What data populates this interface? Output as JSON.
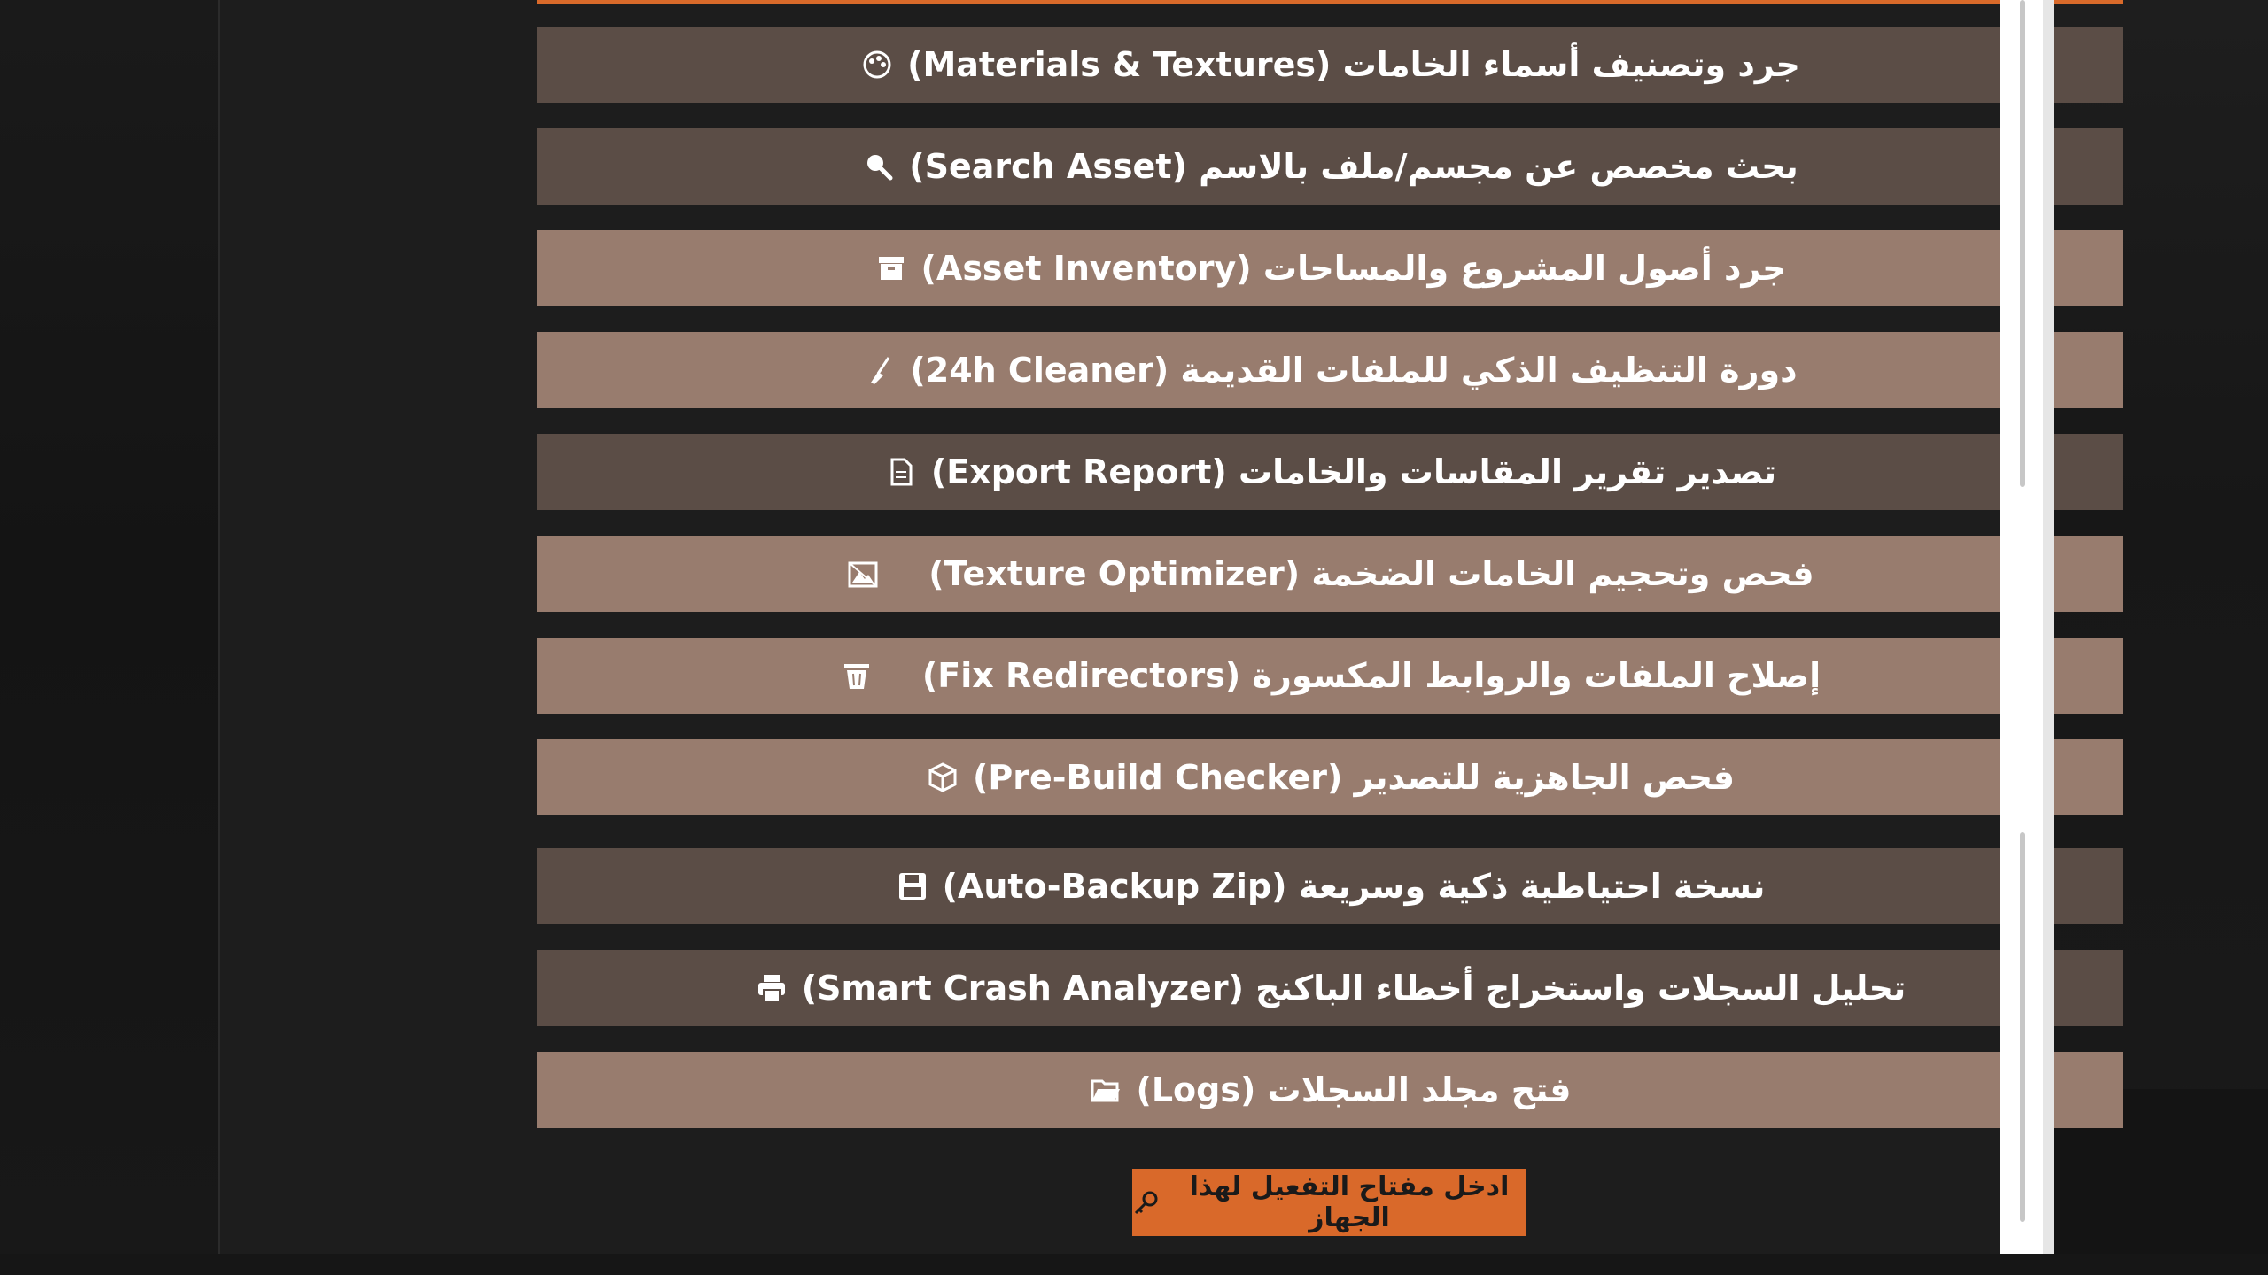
{
  "tools": [
    {
      "label": "جرد وتصنيف أسماء الخامات (Materials & Textures)",
      "icon": "palette-icon",
      "tone": "dark"
    },
    {
      "label": "بحث مخصص عن مجسم/ملف بالاسم (Search Asset)",
      "icon": "magnifier-icon",
      "tone": "dark"
    },
    {
      "label": "جرد أصول المشروع والمساحات (Asset Inventory)",
      "icon": "archive-box-icon",
      "tone": "light"
    },
    {
      "label": "دورة التنظيف الذكي للملفات القديمة (24h Cleaner)",
      "icon": "broom-icon",
      "tone": "light"
    },
    {
      "label": "تصدير تقرير المقاسات والخامات (Export Report)",
      "icon": "document-icon",
      "tone": "dark"
    },
    {
      "label": "فحص وتحجيم الخامات الضخمة (Texture Optimizer)",
      "icon": "image-frame-icon",
      "tone": "light"
    },
    {
      "label": "إصلاح الملفات والروابط المكسورة (Fix Redirectors)",
      "icon": "trash-bin-icon",
      "tone": "light"
    },
    {
      "label": "فحص الجاهزية للتصدير (Pre-Build Checker)",
      "icon": "package-cube-icon",
      "tone": "light"
    },
    {
      "label": "نسخة احتياطية ذكية وسريعة (Auto-Backup Zip)",
      "icon": "floppy-disk-icon",
      "tone": "dark"
    },
    {
      "label": "تحليل السجلات واستخراج أخطاء الباكنج (Smart Crash Analyzer)",
      "icon": "printer-icon",
      "tone": "dark"
    },
    {
      "label": "فتح مجلد السجلات (Logs)",
      "icon": "open-folder-icon",
      "tone": "light"
    }
  ],
  "activation": {
    "label": "ادخل مفتاح التفعيل لهذا الجهاز",
    "icon": "key-icon"
  },
  "colors": {
    "background": "#1d1d1d",
    "button_dark": "#5b4d46",
    "button_light": "#987c6e",
    "accent": "#d9692a",
    "text": "#ffffff"
  }
}
